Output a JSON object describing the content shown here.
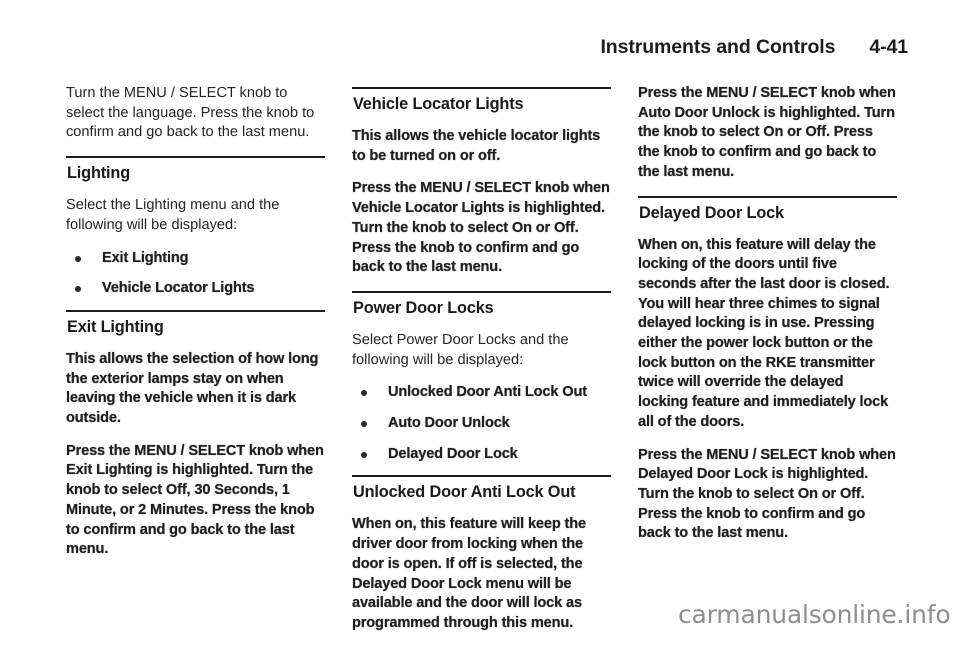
{
  "header": {
    "title": "Instruments and Controls",
    "folio": "4-41"
  },
  "columns": [
    {
      "blocks": [
        {
          "type": "paragraph",
          "text": "Turn the MENU / SELECT knob to select the language. Press the knob to confirm and go back to the last menu."
        },
        {
          "type": "heading",
          "text": "Lighting"
        },
        {
          "type": "paragraph",
          "text": "Select the Lighting menu and the following will be displayed:"
        },
        {
          "type": "bullets",
          "items": [
            "Exit Lighting",
            "Vehicle Locator Lights"
          ]
        },
        {
          "type": "heading",
          "text": "Exit Lighting"
        },
        {
          "type": "paragraph",
          "text": "This allows the selection of how long the exterior lamps stay on when leaving the vehicle when it is dark outside."
        },
        {
          "type": "paragraph",
          "text": "Press the MENU / SELECT knob when Exit Lighting is highlighted. Turn the knob to select Off, 30 Seconds, 1 Minute, or 2 Minutes. Press the knob to confirm and go back to the last menu."
        }
      ]
    },
    {
      "blocks": [
        {
          "type": "heading",
          "text": "Vehicle Locator Lights"
        },
        {
          "type": "paragraph",
          "text": "This allows the vehicle locator lights to be turned on or off."
        },
        {
          "type": "paragraph",
          "text": "Press the MENU / SELECT knob when Vehicle Locator Lights is highlighted. Turn the knob to select On or Off. Press the knob to confirm and go back to the last menu."
        },
        {
          "type": "heading",
          "text": "Power Door Locks"
        },
        {
          "type": "paragraph",
          "text": "Select Power Door Locks and the following will be displayed:"
        },
        {
          "type": "bullets",
          "items": [
            "Unlocked Door Anti Lock Out",
            "Auto Door Unlock",
            "Delayed Door Lock"
          ]
        },
        {
          "type": "heading",
          "text": "Unlocked Door Anti Lock Out"
        },
        {
          "type": "paragraph",
          "text": "When on, this feature will keep the driver door from locking when the door is open. If off is selected, the Delayed Door Lock menu will be available and the door will lock as programmed through this menu."
        }
      ]
    },
    {
      "blocks": [
        {
          "type": "paragraph",
          "text": "Press the MENU / SELECT knob when Auto Door Unlock is highlighted. Turn the knob to select On or Off. Press the knob to confirm and go back to the last menu."
        },
        {
          "type": "heading",
          "text": "Delayed Door Lock"
        },
        {
          "type": "paragraph",
          "text": "When on, this feature will delay the locking of the doors until five seconds after the last door is closed. You will hear three chimes to signal delayed locking is in use. Pressing either the power lock button or the lock button on the RKE transmitter twice will override the delayed locking feature and immediately lock all of the doors."
        },
        {
          "type": "paragraph",
          "text": "Press the MENU / SELECT knob when Delayed Door Lock is highlighted. Turn the knob to select On or Off. Press the knob to confirm and go back to the last menu."
        }
      ]
    }
  ],
  "watermark": "carmanualsonline.info"
}
